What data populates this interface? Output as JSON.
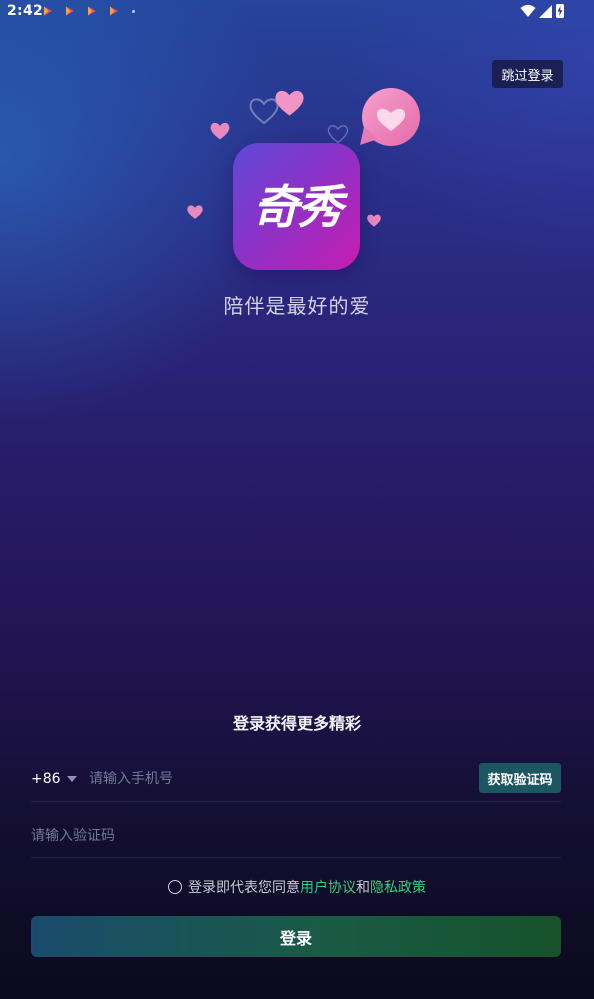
{
  "status_bar": {
    "time": "2:42",
    "notification_icons": [
      "play-store-icon",
      "play-store-icon",
      "play-store-icon",
      "play-store-icon"
    ],
    "system_icons": [
      "wifi-icon",
      "signal-icon",
      "battery-charging-icon"
    ]
  },
  "header": {
    "skip_label": "跳过登录"
  },
  "branding": {
    "logo_text": "奇秀",
    "tagline": "陪伴是最好的爱"
  },
  "login_form": {
    "heading": "登录获得更多精彩",
    "country_code": "+86",
    "phone_placeholder": "请输入手机号",
    "get_code_label": "获取验证码",
    "code_placeholder": "请输入验证码",
    "agreement_prefix": "登录即代表您同意",
    "user_agreement_link": "用户协议",
    "and_text": "和",
    "privacy_policy_link": "隐私政策",
    "login_label": "登录"
  },
  "colors": {
    "accent_green": "#2fd17a",
    "skip_bg": "#1a2054",
    "get_code_bg": "#1c5660",
    "logo_gradient_start": "#5e49d8",
    "logo_gradient_end": "#c81cb0"
  }
}
